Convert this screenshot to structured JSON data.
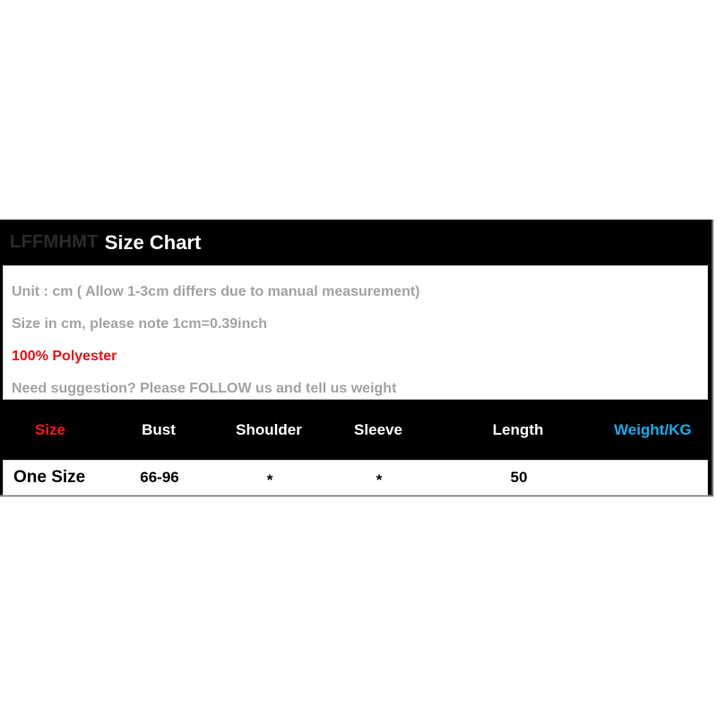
{
  "chart_data": {
    "type": "table",
    "title": "LFFMHMT Size Chart",
    "columns": [
      "Size",
      "Bust",
      "Shoulder",
      "Sleeve",
      "Length",
      "Weight/KG"
    ],
    "rows": [
      [
        "One Size",
        "66-96",
        "*",
        "*",
        "50",
        ""
      ]
    ]
  },
  "header": {
    "brand": "LFFMHMT",
    "title": "Size Chart"
  },
  "notes": {
    "lines": [
      {
        "text": "Unit : cm ( Allow 1-3cm differs due to manual measurement)",
        "style": "muted"
      },
      {
        "text": "Size in cm, please note 1cm=0.39inch",
        "style": "muted"
      },
      {
        "text": "100% Polyester",
        "style": "accent"
      },
      {
        "text": "Need suggestion? Please FOLLOW us and tell us weight",
        "style": "muted"
      }
    ]
  },
  "table": {
    "headers": {
      "size": "Size",
      "bust": "Bust",
      "shoulder": "Shoulder",
      "sleeve": "Sleeve",
      "length": "Length",
      "weight": "Weight/KG"
    },
    "row": {
      "size": "One Size",
      "bust": "66-96",
      "shoulder": "*",
      "sleeve": "*",
      "length": "50",
      "weight": ""
    }
  },
  "colors": {
    "panel_background": "#000000",
    "page_background": "#ffffff",
    "accent_red": "#ee1111",
    "header_size_red": "#f01414",
    "header_weight_cyan": "#17a9e8",
    "muted_gray": "#a3a3a3",
    "brand_gray": "#2b2b2b",
    "border_gray": "#c8c8c8"
  }
}
